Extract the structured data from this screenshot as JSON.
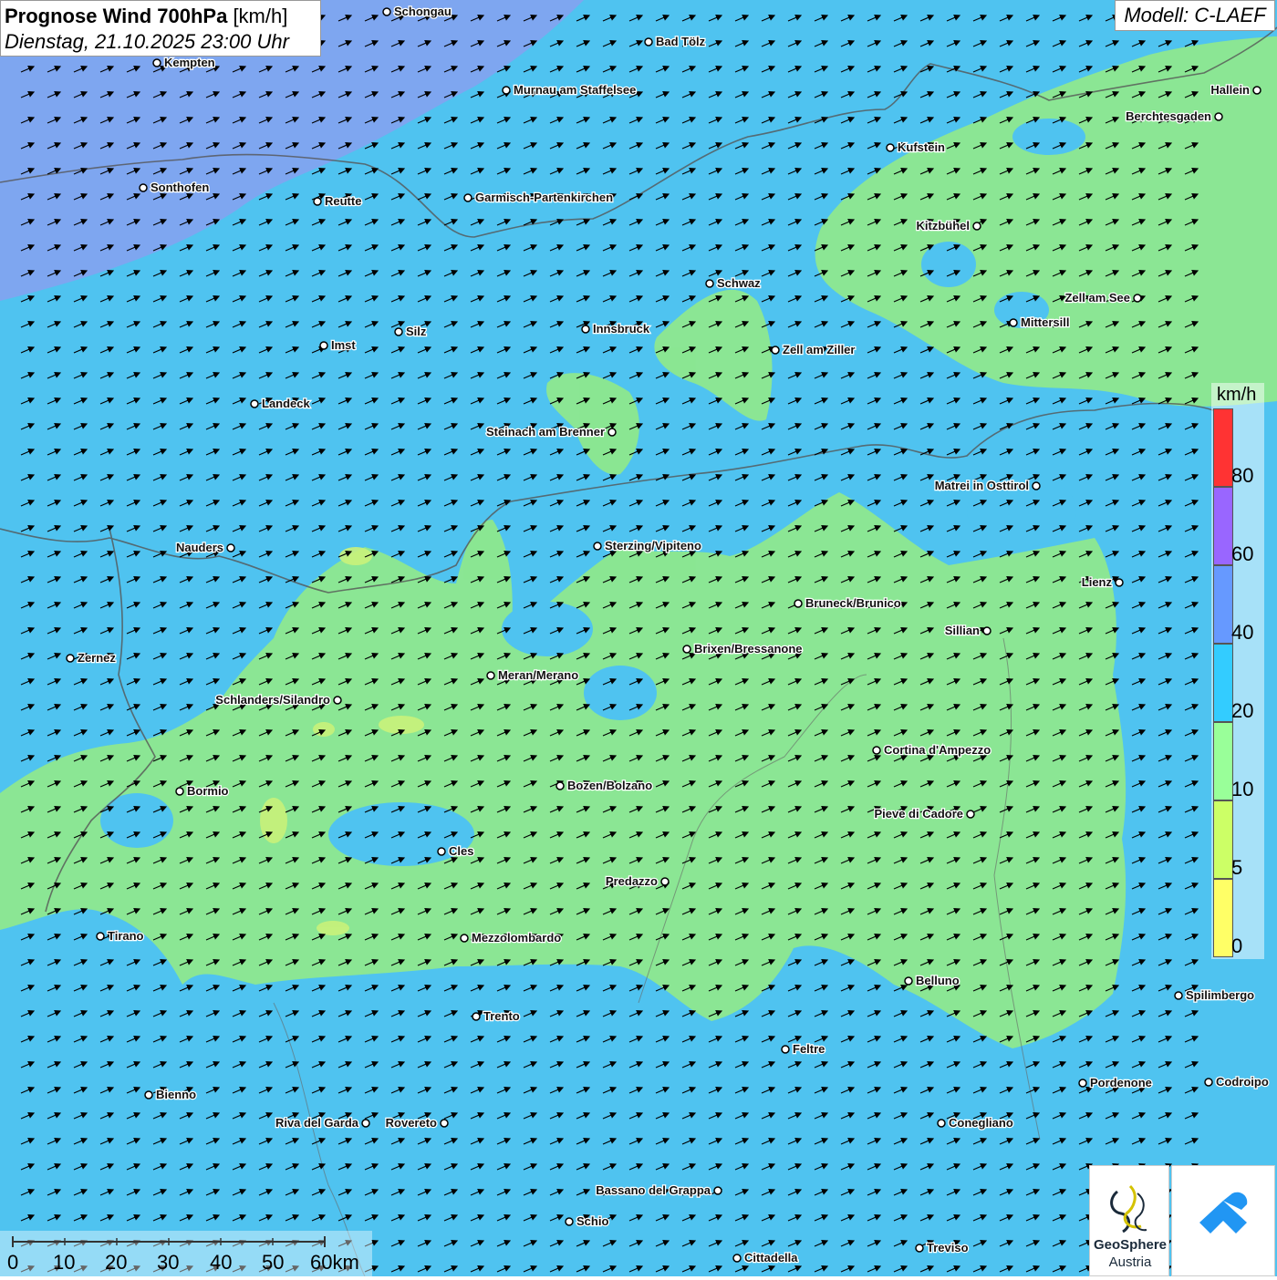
{
  "title": "Prognose Wind 700hPa",
  "title_unit": "[km/h]",
  "subtitle": "Dienstag, 21.10.2025 23:00 Uhr",
  "model": "Modell: C-LAEF",
  "legend": {
    "unit": "km/h",
    "classes": [
      {
        "from": 0,
        "to": 5,
        "color": "#ffff66"
      },
      {
        "from": 5,
        "to": 10,
        "color": "#ccff66"
      },
      {
        "from": 10,
        "to": 20,
        "color": "#99ff99"
      },
      {
        "from": 20,
        "to": 40,
        "color": "#33ccff"
      },
      {
        "from": 40,
        "to": 60,
        "color": "#6699ff"
      },
      {
        "from": 60,
        "to": 80,
        "color": "#9966ff"
      },
      {
        "from": 80,
        "to": 100,
        "color": "#ff3333"
      }
    ],
    "tick_labels": [
      "0",
      "5",
      "10",
      "20",
      "40",
      "60",
      "80"
    ]
  },
  "scalebar": {
    "labels": [
      "0",
      "10",
      "20",
      "30",
      "40",
      "50",
      "60km"
    ]
  },
  "logos": {
    "geosphere_line1": "GeoSphere",
    "geosphere_line2": "Austria"
  },
  "map": {
    "wind_direction": "from west-southwest",
    "cities": [
      "Schongau",
      "Bad Tölz",
      "Kempten",
      "Murnau am Staffelsee",
      "Hallein",
      "Berchtesgaden",
      "Kufstein",
      "Sonthofen",
      "Reutte",
      "Garmisch-Partenkirchen",
      "Kitzbühel",
      "Schwaz",
      "Zell am See",
      "Mittersill",
      "Innsbruck",
      "Silz",
      "Imst",
      "Zell am Ziller",
      "Landeck",
      "Steinach am Brenner",
      "Matrei in Osttirol",
      "Nauders",
      "Sterzing/Vipiteno",
      "Lienz",
      "Bruneck/Brunico",
      "Sillian",
      "Zernez",
      "Brixen/Bressanone",
      "Meran/Merano",
      "Schlanders/Silandro",
      "Cortina d'Ampezzo",
      "Bozen/Bolzano",
      "Bormio",
      "Pieve di Cadore",
      "Cles",
      "Predazzo",
      "Tirano",
      "Mezzolombardo",
      "Belluno",
      "Spilimbergo",
      "Trento",
      "Feltre",
      "Pordenone",
      "Codroipo",
      "Bienno",
      "Riva del Garda",
      "Rovereto",
      "Conegliano",
      "Bassano del Grappa",
      "Schio",
      "Treviso",
      "Cittadella"
    ]
  }
}
